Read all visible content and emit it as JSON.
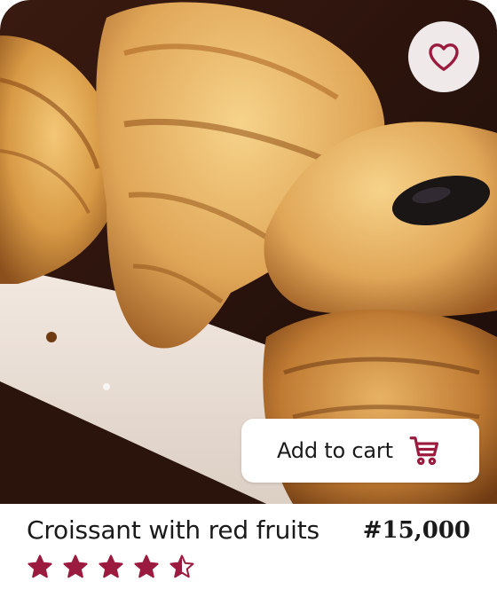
{
  "product": {
    "title": "Croissant with red fruits",
    "price": "#15,000",
    "rating": 4.5,
    "rating_max": 5,
    "image_icon": "croissant-photo"
  },
  "actions": {
    "add_to_cart_label": "Add to cart",
    "cart_icon": "shopping-cart-icon",
    "favorite_icon": "heart-outline-icon"
  },
  "colors": {
    "accent": "#9b1b3f",
    "favorite_bg": "#efe9ea",
    "text": "#1a1a1a"
  }
}
